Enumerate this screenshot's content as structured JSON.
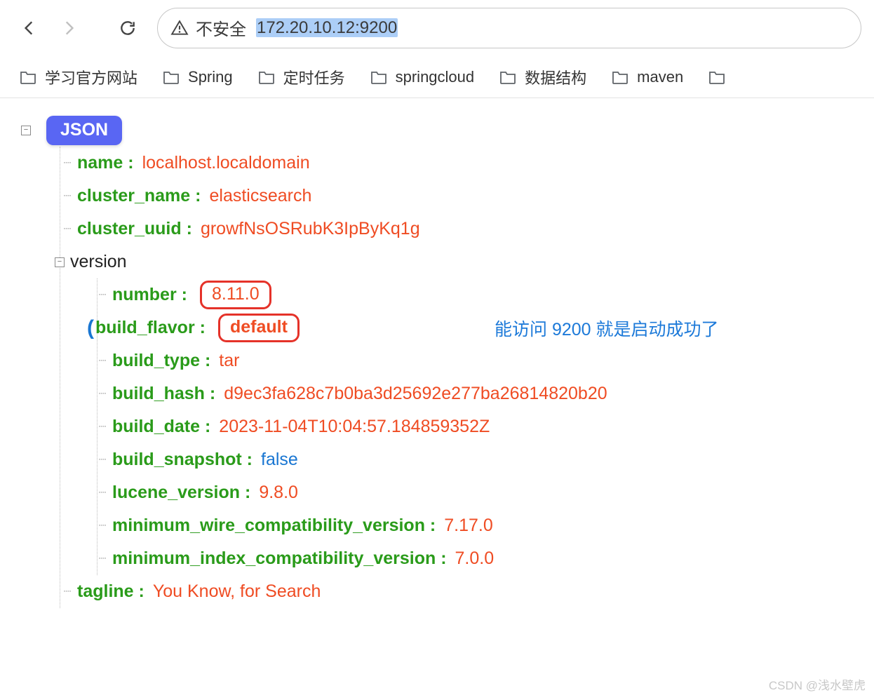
{
  "toolbar": {
    "security_label": "不安全",
    "url_selected": "172.20.10.12:9200"
  },
  "bookmarks": [
    {
      "label": "学习官方网站"
    },
    {
      "label": "Spring"
    },
    {
      "label": "定时任务"
    },
    {
      "label": "springcloud"
    },
    {
      "label": "数据结构"
    },
    {
      "label": "maven"
    },
    {
      "label": ""
    }
  ],
  "json": {
    "root_badge": "JSON",
    "name_key": "name",
    "name_val": "localhost.localdomain",
    "cluster_name_key": "cluster_name",
    "cluster_name_val": "elasticsearch",
    "cluster_uuid_key": "cluster_uuid",
    "cluster_uuid_val": "growfNsOSRubK3IpByKq1g",
    "version_key": "version",
    "version": {
      "number_key": "number",
      "number_val": "8.11.0",
      "build_flavor_key": "build_flavor",
      "build_flavor_val": "default",
      "build_type_key": "build_type",
      "build_type_val": "tar",
      "build_hash_key": "build_hash",
      "build_hash_val": "d9ec3fa628c7b0ba3d25692e277ba26814820b20",
      "build_date_key": "build_date",
      "build_date_val": "2023-11-04T10:04:57.184859352Z",
      "build_snapshot_key": "build_snapshot",
      "build_snapshot_val": "false",
      "lucene_version_key": "lucene_version",
      "lucene_version_val": "9.8.0",
      "min_wire_key": "minimum_wire_compatibility_version",
      "min_wire_val": "7.17.0",
      "min_index_key": "minimum_index_compatibility_version",
      "min_index_val": "7.0.0"
    },
    "tagline_key": "tagline",
    "tagline_val": "You Know, for Search"
  },
  "annotation": "能访问 9200 就是启动成功了",
  "watermark": "CSDN @浅水壁虎"
}
